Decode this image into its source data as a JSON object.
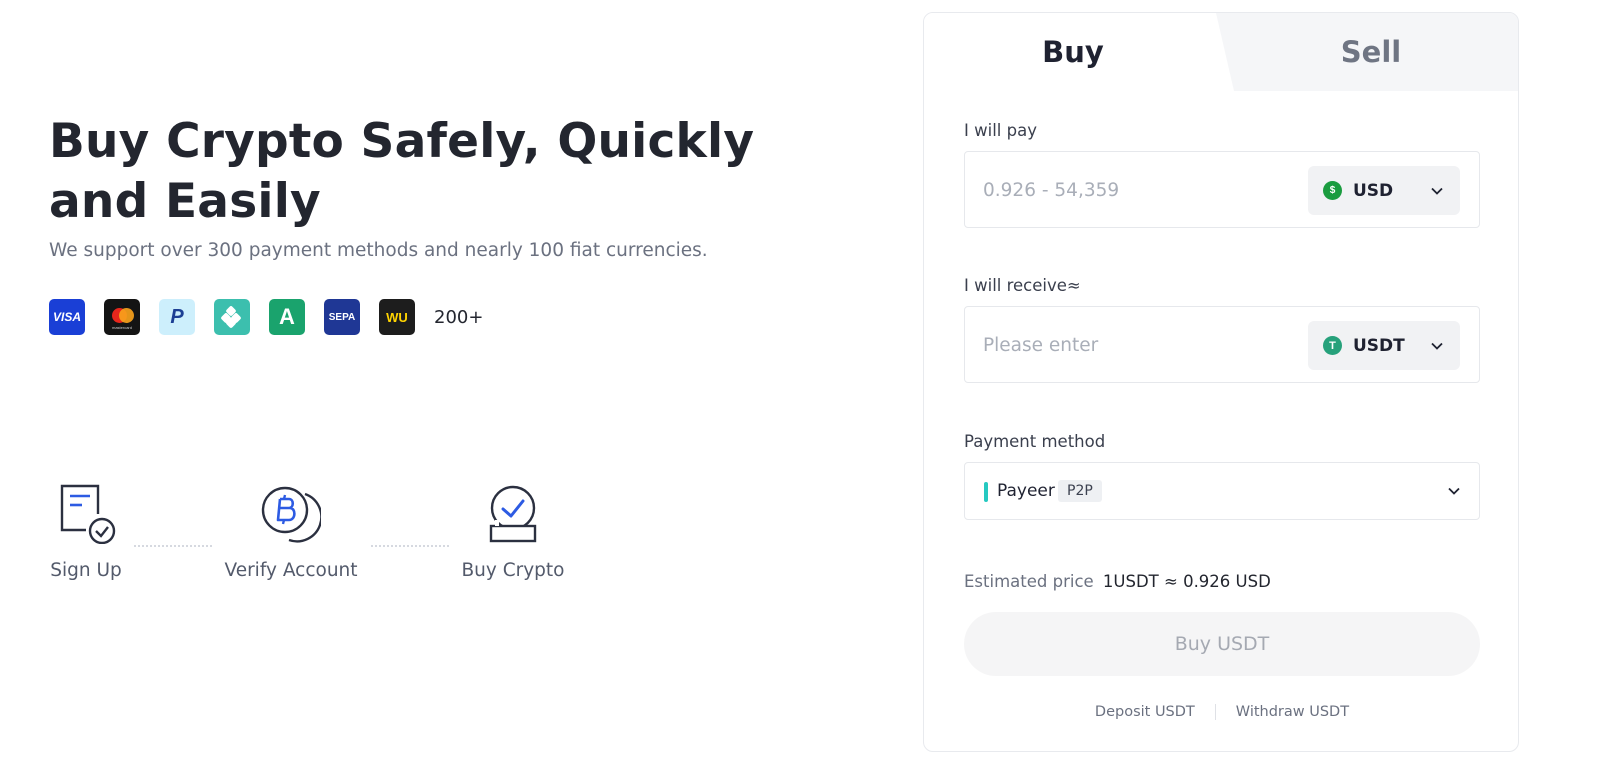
{
  "hero": {
    "title_line1": "Buy Crypto Safely, Quickly",
    "title_line2": "and Easily",
    "subtitle": "We support over 300 payment methods and nearly 100 fiat currencies.",
    "payment_icons": [
      {
        "name": "visa-icon",
        "text": "VISA"
      },
      {
        "name": "mastercard-icon",
        "text": "mastercard"
      },
      {
        "name": "paypal-icon",
        "text": "P"
      },
      {
        "name": "pix-icon",
        "text": ""
      },
      {
        "name": "advcash-icon",
        "text": "A"
      },
      {
        "name": "sepa-icon",
        "text": "SEPA"
      },
      {
        "name": "western-union-icon",
        "text": "WU"
      }
    ],
    "more_methods": "200+"
  },
  "steps": [
    {
      "label": "Sign Up",
      "icon": "sign-up-icon"
    },
    {
      "label": "Verify Account",
      "icon": "verify-account-icon"
    },
    {
      "label": "Buy Crypto",
      "icon": "buy-crypto-icon"
    }
  ],
  "card": {
    "tabs": {
      "buy": "Buy",
      "sell": "Sell",
      "active": "buy"
    },
    "pay": {
      "label": "I will pay",
      "placeholder": "0.926 - 54,359",
      "currency": "USD",
      "currency_icon": "usd-coin-icon"
    },
    "receive": {
      "label": "I will receive≈",
      "placeholder": "Please enter",
      "currency": "USDT",
      "currency_icon": "usdt-coin-icon"
    },
    "payment_method": {
      "label": "Payment method",
      "name": "Payeer",
      "tag": "P2P"
    },
    "estimated": {
      "label": "Estimated price",
      "value": "1USDT ≈ 0.926 USD"
    },
    "buy_button": "Buy USDT",
    "footer": {
      "deposit": "Deposit USDT",
      "withdraw": "Withdraw USDT"
    }
  },
  "colors": {
    "accent_teal": "#26c9c1",
    "usd_green": "#1a9c3f",
    "usdt_green": "#26a17b",
    "step_icon_blue": "#2d5be3",
    "step_icon_dark": "#2b3040"
  }
}
